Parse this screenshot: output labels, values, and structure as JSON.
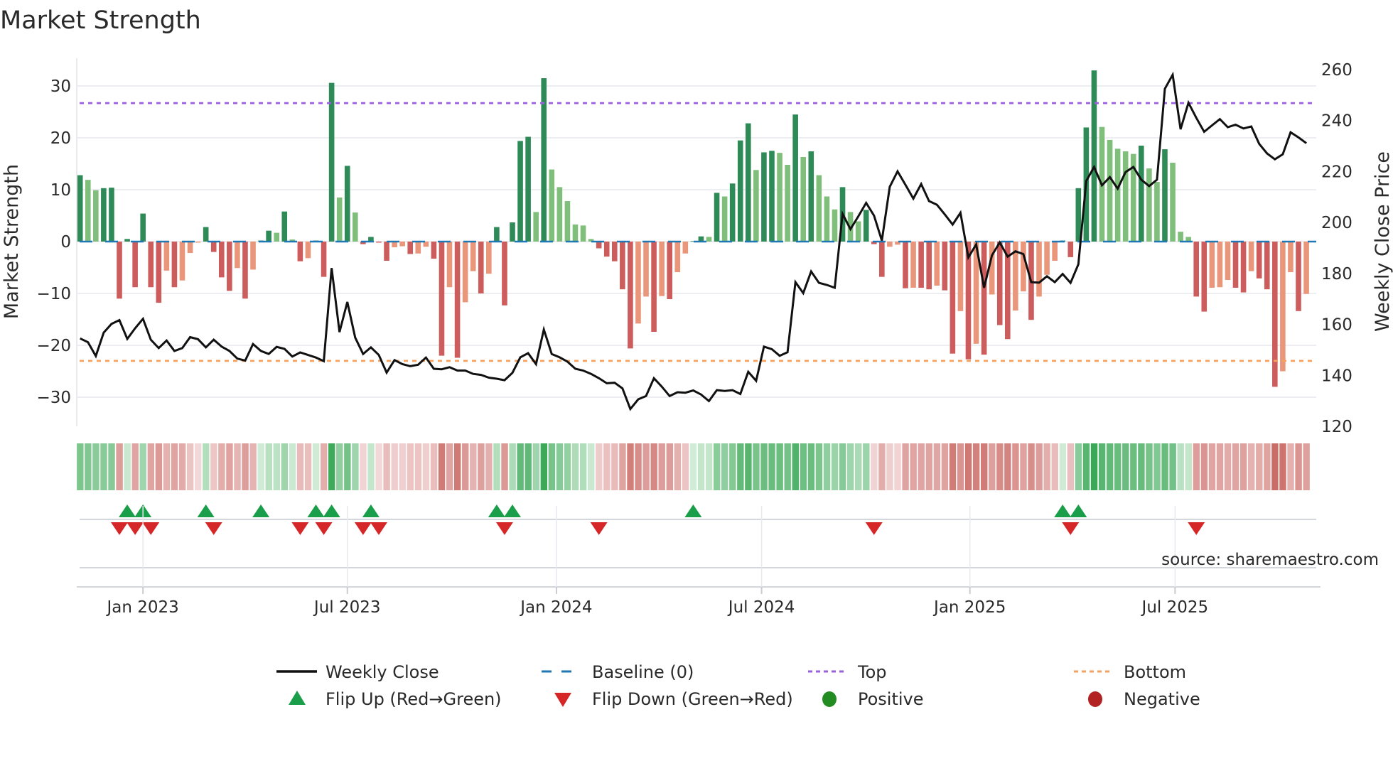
{
  "page": {
    "title": "Market Strength",
    "source": "source: sharemaestro.com"
  },
  "colors": {
    "bar_up_strong": "#2e8b57",
    "bar_up_weak": "#7fbf7b",
    "bar_down_strong": "#cd5c5c",
    "bar_down_weak": "#e9967a",
    "price_line": "#111111",
    "baseline": "#1f77b4",
    "top_line": "#9b5fe0",
    "bottom_line": "#f4a261",
    "flip_up": "#1a9e4a",
    "flip_down": "#d62728",
    "positive": "#228b22",
    "negative": "#b22222",
    "source_text": "#8a8a8a"
  },
  "legend": [
    {
      "label": "Weekly Close",
      "icon": "solid-line-icon"
    },
    {
      "label": "Baseline (0)",
      "icon": "dashed-line-icon"
    },
    {
      "label": "Top",
      "icon": "dotted-purple-line-icon"
    },
    {
      "label": "Bottom",
      "icon": "dotted-orange-line-icon"
    },
    {
      "label": "Flip Up (Red→Green)",
      "icon": "triangle-up-icon"
    },
    {
      "label": "Flip Down (Green→Red)",
      "icon": "triangle-down-icon"
    },
    {
      "label": "Positive",
      "icon": "green-circle-icon"
    },
    {
      "label": "Negative",
      "icon": "red-circle-icon"
    }
  ],
  "chart_data": {
    "type": "bar",
    "title": "Market Strength",
    "ylabel": "Market Strength",
    "y2label": "Weekly Close Price",
    "ylim": [
      -35.5,
      35.3
    ],
    "y2lim": [
      120,
      260
    ],
    "yticks": [
      30,
      20,
      10,
      0,
      -10,
      -20,
      -30
    ],
    "ytick_labels": [
      "30",
      "20",
      "10",
      "0",
      "−10",
      "−20",
      "−30"
    ],
    "y2ticks": [
      260,
      240,
      220,
      200,
      180,
      160,
      140,
      120
    ],
    "y2tick_labels": [
      "260",
      "240",
      "220",
      "200",
      "180",
      "160",
      "140",
      "120"
    ],
    "xunit": "week index",
    "xticks": [
      {
        "label": "Jan 2023",
        "week": 8.0
      },
      {
        "label": "Jul 2023",
        "week": 34.0
      },
      {
        "label": "Jan 2024",
        "week": 60.6
      },
      {
        "label": "Jul 2024",
        "week": 86.7
      },
      {
        "label": "Jan 2025",
        "week": 113.2
      },
      {
        "label": "Jul 2025",
        "week": 139.3
      }
    ],
    "top_level": 26.7,
    "bottom_level": -23.0,
    "baseline": 0,
    "grid": true,
    "legend_placement": "bottom",
    "series": [
      {
        "name": "Market Strength",
        "values": [
          12.8,
          11.9,
          9.9,
          10.3,
          10.4,
          -11.0,
          0.5,
          -8.8,
          5.4,
          -8.8,
          -11.8,
          -5.6,
          -8.8,
          -7.5,
          -2.2,
          -0.2,
          2.8,
          -2.0,
          -6.9,
          -9.5,
          -5.1,
          -11.0,
          -5.4,
          0.2,
          2.1,
          1.7,
          5.8,
          0.4,
          -3.8,
          -3.2,
          0.2,
          -6.8,
          30.6,
          8.5,
          14.6,
          5.6,
          -0.5,
          0.9,
          -0.2,
          -3.7,
          -1.1,
          -0.9,
          -2.4,
          -2.3,
          -1.0,
          -3.3,
          -22.0,
          -8.8,
          -22.4,
          -11.7,
          -5.7,
          -10.0,
          -6.2,
          2.8,
          -12.3,
          3.7,
          19.4,
          20.2,
          5.7,
          31.5,
          13.9,
          10.5,
          7.8,
          3.3,
          3.1,
          0.5,
          -1.3,
          -2.9,
          -3.8,
          -9.2,
          -20.6,
          -15.8,
          -10.6,
          -17.4,
          -10.5,
          -11.1,
          -5.9,
          -2.3,
          0.1,
          1.0,
          0.9,
          9.4,
          8.7,
          11.2,
          19.5,
          22.8,
          13.8,
          17.2,
          17.5,
          17.1,
          14.8,
          24.5,
          16.3,
          17.4,
          12.8,
          8.7,
          6.2,
          10.5,
          5.7,
          3.9,
          6.1,
          -0.5,
          -6.8,
          -1.0,
          -0.6,
          -9.0,
          -8.9,
          -8.9,
          -9.2,
          -8.5,
          -9.4,
          -21.6,
          -13.4,
          -22.7,
          -19.7,
          -21.8,
          -10.2,
          -16.1,
          -18.8,
          -13.3,
          -9.6,
          -15.1,
          -10.6,
          -6.4,
          -3.7,
          0.2,
          -3.0,
          10.3,
          22.0,
          33.0,
          22.1,
          19.6,
          17.9,
          17.4,
          16.9,
          18.5,
          14.1,
          11.5,
          17.8,
          15.2,
          1.9,
          0.9,
          -10.6,
          -13.5,
          -8.9,
          -8.8,
          -7.4,
          -8.9,
          -9.8,
          -5.7,
          -7.1,
          -9.2,
          -28.0,
          -25.0,
          -5.9,
          -13.4,
          -10.1
        ]
      },
      {
        "name": "Weekly Close",
        "axis": "right",
        "values": [
          154.5,
          153,
          147.6,
          156.8,
          160.2,
          161.7,
          154.3,
          158.5,
          162.2,
          154,
          150.7,
          153.7,
          149.6,
          150.7,
          155,
          154.2,
          151,
          154,
          151.3,
          149.6,
          146.6,
          145.8,
          152.3,
          149.6,
          148.4,
          151.2,
          150.4,
          147.4,
          149,
          148,
          147,
          145.6,
          182.1,
          157,
          168.8,
          154.8,
          148.4,
          151,
          148,
          141.1,
          146,
          144.4,
          143.6,
          144.2,
          147,
          142.6,
          142.4,
          143.2,
          141.9,
          141.9,
          140.6,
          140.2,
          139.1,
          138.7,
          138.1,
          141,
          147.1,
          148.7,
          144.4,
          158,
          148.4,
          147.1,
          145.4,
          142.6,
          141.9,
          140.6,
          138.9,
          136.9,
          137.1,
          134.9,
          126.8,
          130.6,
          131.9,
          138.9,
          135.6,
          131.9,
          133.4,
          133.2,
          134.1,
          132.5,
          129.9,
          134.2,
          133.9,
          134.2,
          132.7,
          141.4,
          137.9,
          151.3,
          150.3,
          147.7,
          149.1,
          176.6,
          172.3,
          180.8,
          176.3,
          175.5,
          174.4,
          203.4,
          197.4,
          202.4,
          207.7,
          202.7,
          192.9,
          214,
          220.1,
          214.8,
          209.4,
          215.1,
          208.4,
          207,
          203.2,
          199.2,
          203.8,
          186.3,
          191.4,
          174.4,
          187.1,
          192.2,
          186.6,
          188.7,
          187.6,
          176.6,
          176.4,
          178.9,
          176.6,
          179.8,
          176.3,
          183.6,
          216.3,
          221.8,
          214.6,
          217.8,
          213.3,
          219.8,
          221.8,
          216.8,
          214.3,
          216.8,
          252.5,
          258,
          236.6,
          247,
          241.1,
          235.6,
          238.1,
          240.6,
          237.4,
          238.4,
          236.9,
          237.7,
          230.9,
          227.1,
          224.8,
          226.8,
          235.4,
          233.4,
          231.1
        ]
      }
    ]
  }
}
